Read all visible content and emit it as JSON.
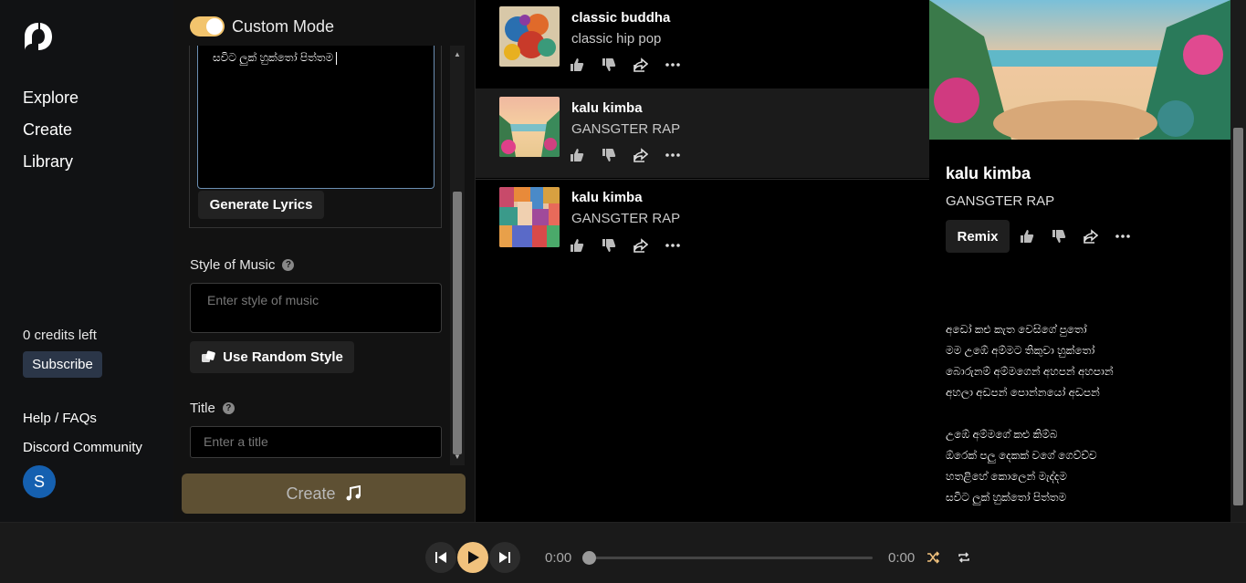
{
  "sidebar": {
    "nav": [
      {
        "label": "Explore"
      },
      {
        "label": "Create"
      },
      {
        "label": "Library"
      }
    ],
    "credits": "0 credits left",
    "subscribe": "Subscribe",
    "help": "Help / FAQs",
    "discord": "Discord Community",
    "avatar_initial": "S"
  },
  "create": {
    "mode_label": "Custom Mode",
    "lyrics_text": "සවිට ලුක් හුක්තෝ පිත්තම",
    "generate_lyrics": "Generate Lyrics",
    "style_label": "Style of Music",
    "style_placeholder": "Enter style of music",
    "random_style": "Use Random Style",
    "title_label": "Title",
    "title_placeholder": "Enter a title",
    "create_button": "Create"
  },
  "songs": [
    {
      "title": "classic buddha",
      "style": "classic hip pop"
    },
    {
      "title": "kalu kimba",
      "style": "GANSGTER RAP"
    },
    {
      "title": "kalu kimba",
      "style": "GANSGTER RAP"
    }
  ],
  "detail": {
    "title": "kalu kimba",
    "style": "GANSGTER RAP",
    "remix": "Remix",
    "lyrics": [
      "අඩෝ කළු කැත වෙසිගේ පුතෝ",
      "මම උඹේ අම්මට තිකුවා හුක්තෝ",
      "බොරුනම් අම්මගෙන් අහපන් අහපාන්",
      "අහලා අඩපන් පොන්නයෝ අඩපන්",
      "",
      "උඹේ අම්මගේ කළු කිම්බ",
      "ඕරෙක් පලු දෙකක් වගේ ගෙව්ච්ච",
      "හතළිහේ කොලෙන් මැද්දම",
      "සවිට ලුක් හුක්තෝ පිත්තම"
    ]
  },
  "player": {
    "current_time": "0:00",
    "duration": "0:00",
    "progress": 0
  },
  "colors": {
    "accent": "#f1c27d",
    "create_button": "#5e5033",
    "subscribe": "#2b3648",
    "avatar": "#1560b0"
  }
}
